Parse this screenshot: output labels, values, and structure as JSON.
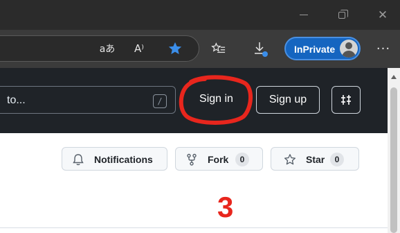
{
  "browser": {
    "window_controls": {
      "minimize_icon": "minimize-icon",
      "restore_icon": "restore-icon",
      "close_icon": "close-icon"
    },
    "toolbar": {
      "translate_glyph": "aあ",
      "read_aloud_glyph": "A⁾",
      "inprivate_label": "InPrivate",
      "more_glyph": "···"
    }
  },
  "header": {
    "search_text": "to...",
    "search_shortcut": "/",
    "sign_in_label": "Sign in",
    "sign_up_label": "Sign up"
  },
  "repo_actions": {
    "notifications_label": "Notifications",
    "fork_label": "Fork",
    "fork_count": "0",
    "star_label": "Star",
    "star_count": "0"
  },
  "annotation": {
    "step_number": "3",
    "color": "#e8261d"
  },
  "colors": {
    "titlebar": "#2b2b2b",
    "toolbar": "#3b3b3b",
    "header": "#1f2328",
    "inprivate": "#1565c0"
  }
}
